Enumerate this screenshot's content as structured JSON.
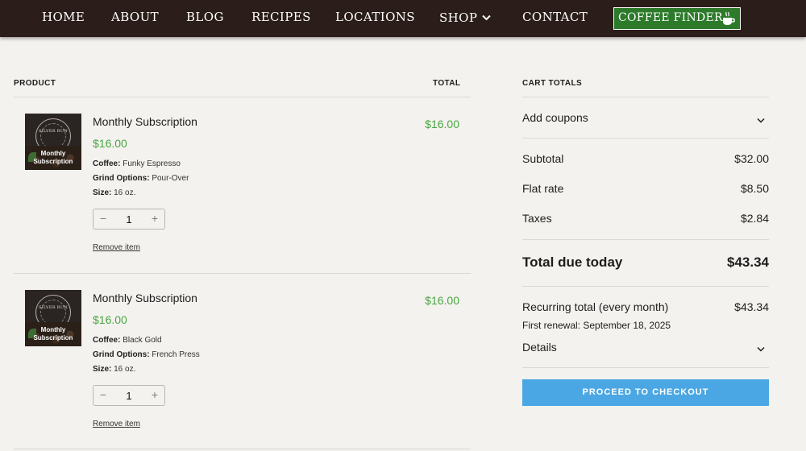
{
  "nav": {
    "items": [
      "HOME",
      "ABOUT",
      "BLOG",
      "RECIPES",
      "LOCATIONS",
      "SHOP",
      "CONTACT"
    ],
    "finder_label": "COFFEE FINDER"
  },
  "table": {
    "col_product": "PRODUCT",
    "col_total": "TOTAL"
  },
  "items": [
    {
      "thumb_brand": "SILVER RUN",
      "thumb_label_1": "Monthly",
      "thumb_label_2": "Subscription",
      "name": "Monthly Subscription",
      "price": "$16.00",
      "coffee_label": "Coffee:",
      "coffee_value": "Funky Espresso",
      "grind_label": "Grind Options:",
      "grind_value": "Pour-Over",
      "size_label": "Size:",
      "size_value": "16 oz.",
      "quantity": "1",
      "total": "$16.00",
      "remove_label": "Remove item"
    },
    {
      "thumb_brand": "SILVER RUN",
      "thumb_label_1": "Monthly",
      "thumb_label_2": "Subscription",
      "name": "Monthly Subscription",
      "price": "$16.00",
      "coffee_label": "Coffee:",
      "coffee_value": "Black Gold",
      "grind_label": "Grind Options:",
      "grind_value": "French Press",
      "size_label": "Size:",
      "size_value": "16 oz.",
      "quantity": "1",
      "total": "$16.00",
      "remove_label": "Remove item"
    }
  ],
  "cart": {
    "title": "CART TOTALS",
    "coupons_label": "Add coupons",
    "subtotal_label": "Subtotal",
    "subtotal_value": "$32.00",
    "flat_rate_label": "Flat rate",
    "flat_rate_value": "$8.50",
    "taxes_label": "Taxes",
    "taxes_value": "$2.84",
    "due_label": "Total due today",
    "due_value": "$43.34",
    "recurring_label": "Recurring total (every month)",
    "recurring_value": "$43.34",
    "renewal_text": "First renewal: September 18, 2025",
    "details_label": "Details",
    "checkout_label": "PROCEED TO CHECKOUT"
  },
  "colors": {
    "nav_bg": "#2b1d19",
    "finder_bg": "#2c7a2a",
    "price_green": "#4aa543",
    "checkout_blue": "#4ba7e3",
    "page_bg": "#f3f2ee"
  },
  "icons": {
    "shop_dropdown": "chevron-down-icon",
    "finder": "coffee-cup-icon",
    "coupons_toggle": "chevron-down-icon",
    "details_toggle": "chevron-down-icon"
  }
}
